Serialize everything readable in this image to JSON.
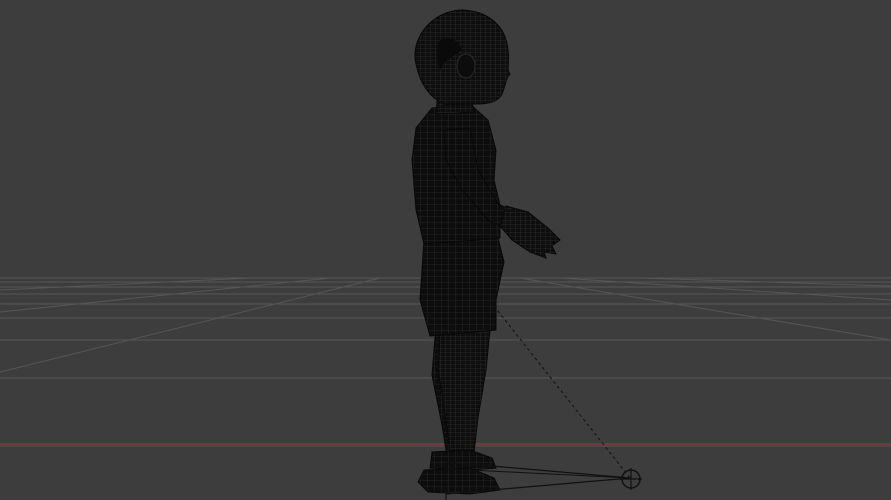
{
  "viewport": {
    "mode": "wireframe",
    "background_color": "#3d3d3d",
    "grid_color": "#555555",
    "x_axis_color": "#8b3a3a",
    "mesh_color": "#0d0d0d",
    "wire_color": "#2a2a2a",
    "rig_line_color": "#111111"
  },
  "scene": {
    "object": "child-character-mesh",
    "view": "side",
    "ik_control": "foot-ik-target-icon"
  }
}
